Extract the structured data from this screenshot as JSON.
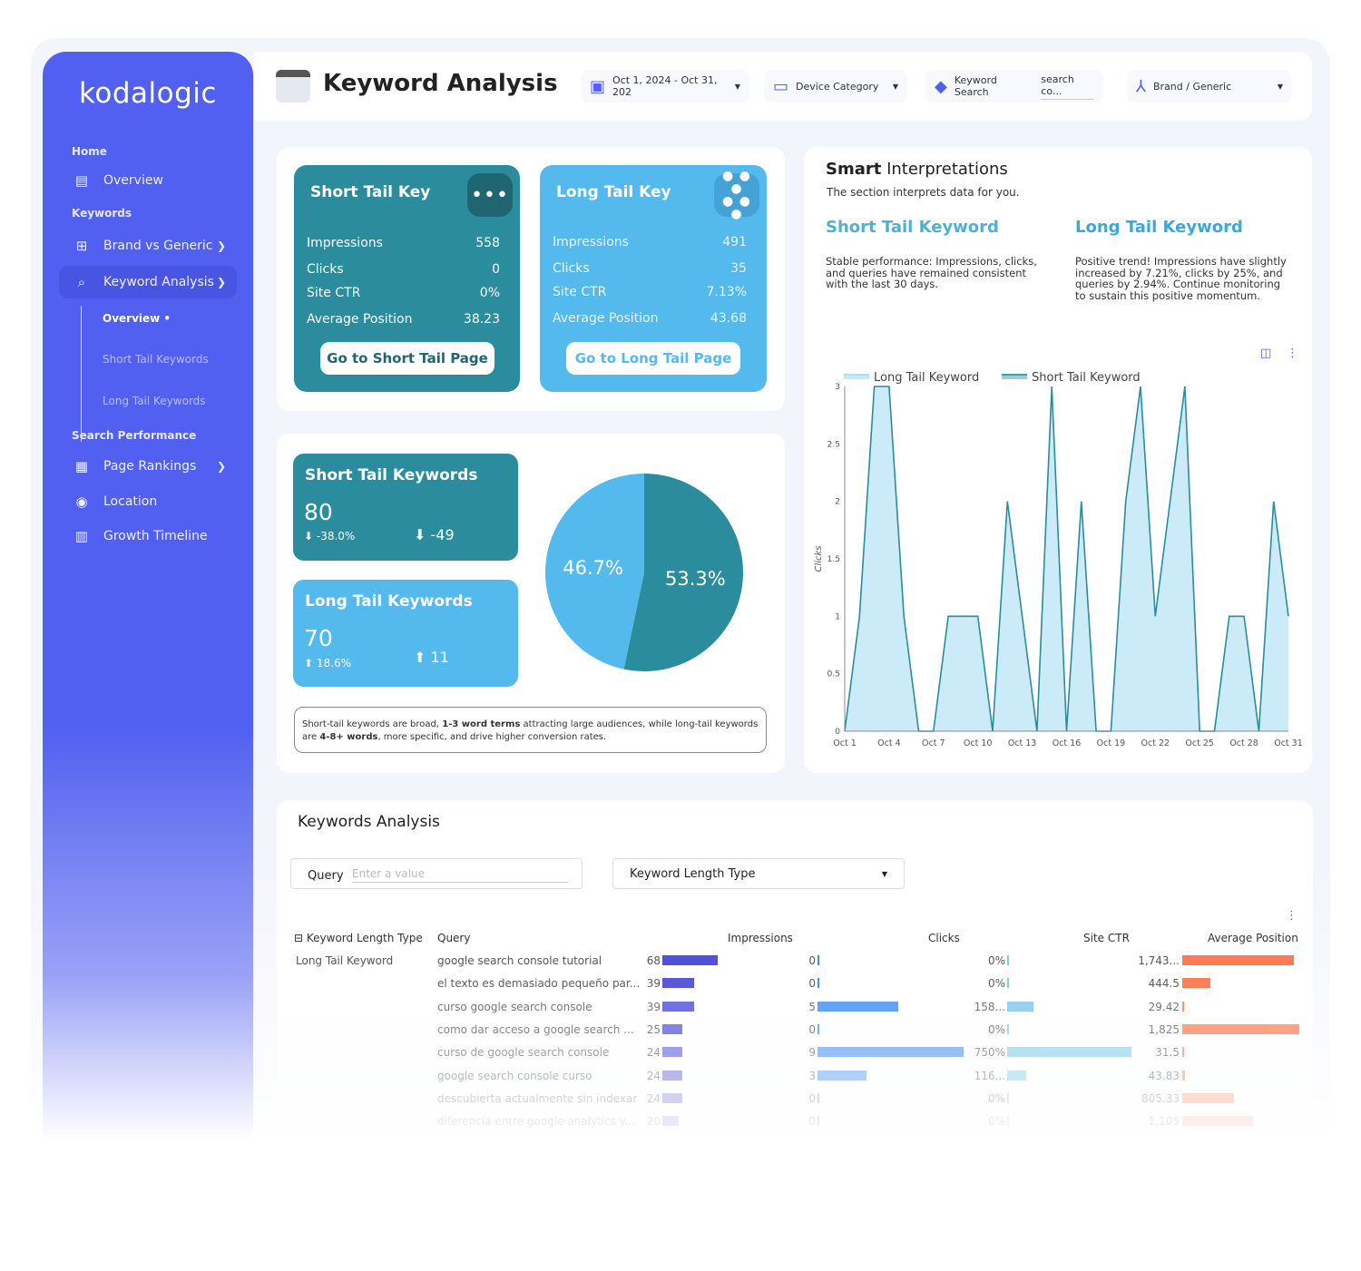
{
  "sidebar": {
    "logo": "kodalogic",
    "sections": [
      "Home",
      "Keywords",
      "Search Performance"
    ],
    "items": [
      {
        "label": "Overview",
        "icon": "layout-icon"
      },
      {
        "label": "Brand vs Generic",
        "icon": "add-layers-icon"
      },
      {
        "label": "Keyword Analysis",
        "icon": "search-chart-icon"
      },
      {
        "label": "Page Rankings",
        "icon": "grid-list-icon"
      },
      {
        "label": "Location",
        "icon": "location-pin-icon"
      },
      {
        "label": "Growth Timeline",
        "icon": "bar-chart-icon"
      }
    ],
    "subitems": [
      "Overview •",
      "Short Tail Keywords",
      "Long Tail Keywords"
    ]
  },
  "header": {
    "title": "Keyword Analysis",
    "date_range": "Oct 1, 2024 - Oct 31, 202",
    "device": "Device Category",
    "keyword_search_label": "Keyword Search",
    "keyword_search_placeholder": "search co...",
    "brand": "Brand / Generic"
  },
  "cards": [
    {
      "title": "Short Tail Key",
      "color": "#2a8c9c",
      "button": "Go to Short Tail Page",
      "metrics": [
        [
          "Impressions",
          "558"
        ],
        [
          "Clicks",
          "0"
        ],
        [
          "Site CTR",
          "0%"
        ],
        [
          "Average Position",
          "38.23"
        ]
      ]
    },
    {
      "title": "Long Tail Key",
      "color": "#54b9ec",
      "button": "Go to Long Tail Page",
      "metrics": [
        [
          "Impressions",
          "491"
        ],
        [
          "Clicks",
          "35"
        ],
        [
          "Site CTR",
          "7.13%"
        ],
        [
          "Average Position",
          "43.68"
        ]
      ]
    }
  ],
  "summary": [
    {
      "title": "Short Tail Keywords",
      "value": "80",
      "pct": "-38.0%",
      "delta": "-49",
      "dir": "down"
    },
    {
      "title": "Long Tail Keywords",
      "value": "70",
      "pct": "18.6%",
      "delta": "11",
      "dir": "up"
    }
  ],
  "pie": {
    "slices": [
      {
        "label": "Short Tail Keywords",
        "value": 53.3,
        "text": "53.3%",
        "color": "#2a8c9c"
      },
      {
        "label": "Long Tail Keywords",
        "value": 46.7,
        "text": "46.7%",
        "color": "#54b9ec"
      }
    ]
  },
  "note": {
    "p1": "Short-tail keywords are broad, ",
    "b1": "1-3 word terms",
    "p2": " attracting large audiences, while long-tail keywords are ",
    "b2": "4-8+ words",
    "p3": ", more specific, and drive higher conversion rates."
  },
  "interpretations": {
    "title_bold": "Smart",
    "title_rest": " Interpretations",
    "subtitle": "The section interprets data for you.",
    "short": {
      "title": "Short Tail Keyword",
      "text": "Stable performance: Impressions, clicks, and queries have remained consistent with the last 30 days."
    },
    "long": {
      "title": "Long Tail Keyword",
      "text": "Positive trend! Impressions have slightly increased by 7.21%, clicks by 25%, and queries by 2.94%. Continue monitoring to sustain this positive momentum."
    }
  },
  "chart_data": {
    "type": "area",
    "ylabel": "Clicks",
    "ylim": [
      0,
      3
    ],
    "yticks": [
      "0",
      "0.5",
      "1",
      "1.5",
      "2",
      "2.5",
      "3"
    ],
    "xticks": [
      "Oct 1",
      "Oct 4",
      "Oct 7",
      "Oct 10",
      "Oct 13",
      "Oct 16",
      "Oct 19",
      "Oct 22",
      "Oct 25",
      "Oct 28",
      "Oct 31"
    ],
    "legend": [
      {
        "name": "Long Tail Keyword",
        "color": "#c6e9f7"
      },
      {
        "name": "Short Tail Keyword",
        "color": "#2a8c9c"
      }
    ],
    "legend_position": "top",
    "x": [
      "Oct 1",
      "Oct 2",
      "Oct 3",
      "Oct 4",
      "Oct 5",
      "Oct 6",
      "Oct 7",
      "Oct 8",
      "Oct 9",
      "Oct 10",
      "Oct 11",
      "Oct 12",
      "Oct 13",
      "Oct 14",
      "Oct 15",
      "Oct 16",
      "Oct 17",
      "Oct 18",
      "Oct 19",
      "Oct 20",
      "Oct 21",
      "Oct 22",
      "Oct 23",
      "Oct 24",
      "Oct 25",
      "Oct 26",
      "Oct 27",
      "Oct 28",
      "Oct 29",
      "Oct 30",
      "Oct 31"
    ],
    "values": [
      0,
      1,
      3,
      3,
      1,
      0,
      0,
      1,
      1,
      1,
      0,
      2,
      1,
      0,
      3,
      0,
      2,
      0,
      0,
      2,
      3,
      1,
      2,
      3,
      0,
      0,
      1,
      1,
      0,
      2,
      1
    ]
  },
  "table": {
    "title": "Keywords Analysis",
    "query_label": "Query",
    "query_placeholder": "Enter a value",
    "length_filter": "Keyword Length Type",
    "headers": [
      "Keyword Length Type",
      "Query",
      "Impressions",
      "Clicks",
      "Site CTR",
      "Average Position"
    ],
    "group": "Long Tail Keyword",
    "rows": [
      {
        "query": "google search console tutorial",
        "impressions": 68,
        "clicks": 0,
        "ctr": "0%",
        "ctr_value": 0,
        "position": "1,743...",
        "position_value": 1743
      },
      {
        "query": "el texto es demasiado pequeño par...",
        "impressions": 39,
        "clicks": 0,
        "ctr": "0%",
        "ctr_value": 0,
        "position": "444.5",
        "position_value": 444.5
      },
      {
        "query": "curso google search console",
        "impressions": 39,
        "clicks": 5,
        "ctr": "158...",
        "ctr_value": 158,
        "position": "29.42",
        "position_value": 29.42
      },
      {
        "query": "como dar acceso a google search ...",
        "impressions": 25,
        "clicks": 0,
        "ctr": "0%",
        "ctr_value": 0,
        "position": "1,825",
        "position_value": 1825
      },
      {
        "query": "curso de google search console",
        "impressions": 24,
        "clicks": 9,
        "ctr": "750%",
        "ctr_value": 750,
        "position": "31.5",
        "position_value": 31.5
      },
      {
        "query": "google search console curso",
        "impressions": 24,
        "clicks": 3,
        "ctr": "116...",
        "ctr_value": 116,
        "position": "43.83",
        "position_value": 43.83
      },
      {
        "query": "descubierta actualmente sin indexar",
        "impressions": 24,
        "clicks": 0,
        "ctr": "0%",
        "ctr_value": 0,
        "position": "805.33",
        "position_value": 805.33
      },
      {
        "query": "diferencia entre google analytics y...",
        "impressions": 20,
        "clicks": 0,
        "ctr": "0%",
        "ctr_value": 0,
        "position": "1,105",
        "position_value": 1105
      }
    ],
    "colors": {
      "impressions": "#5050d8",
      "clicks": "#3d8ef0",
      "ctr": "#7cc8ec",
      "position": "#ff7a50"
    }
  }
}
